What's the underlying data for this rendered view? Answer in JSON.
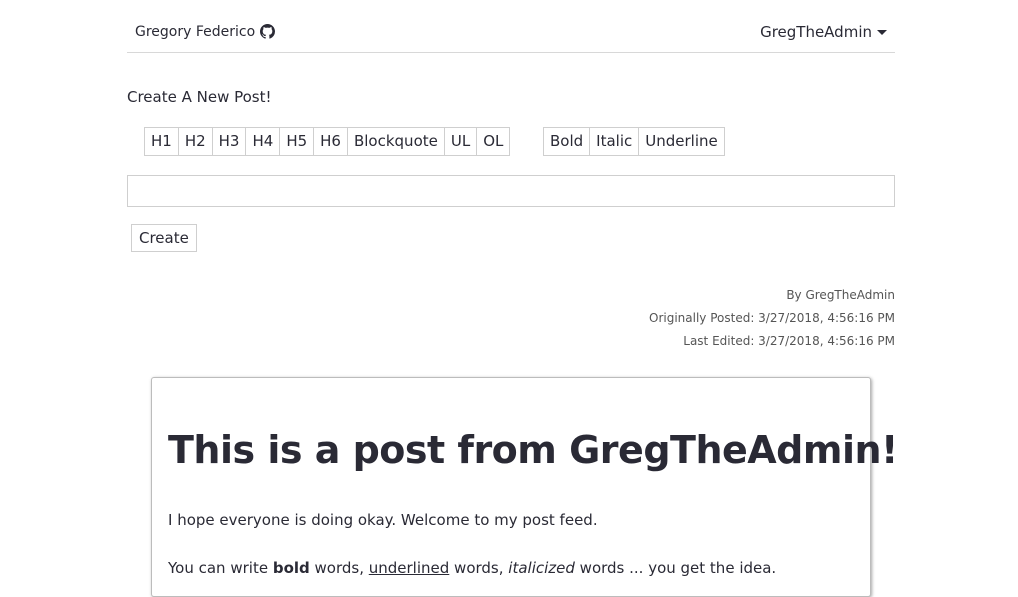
{
  "navbar": {
    "brand": "Gregory Federico",
    "github_icon": "github-icon",
    "user": "GregTheAdmin",
    "caret_icon": "caret-down-icon"
  },
  "create": {
    "heading": "Create A New Post!",
    "heading_tools": [
      "H1",
      "H2",
      "H3",
      "H4",
      "H5",
      "H6",
      "Blockquote",
      "UL",
      "OL"
    ],
    "style_tools": [
      "Bold",
      "Italic",
      "Underline"
    ],
    "editor_value": "",
    "button": "Create"
  },
  "post": {
    "author": "By GregTheAdmin",
    "posted": "Originally Posted: 3/27/2018, 4:56:16 PM",
    "edited": "Last Edited: 3/27/2018, 4:56:16 PM",
    "title": "This is a post from GregTheAdmin!",
    "paragraph1": "I hope everyone is doing okay. Welcome to my post feed.",
    "p2": {
      "t1": "You can write ",
      "bold": "bold",
      "t2": " words, ",
      "underlined": "underlined",
      "t3": " words, ",
      "italic": "italicized",
      "t4": " words ... you get the idea."
    }
  }
}
